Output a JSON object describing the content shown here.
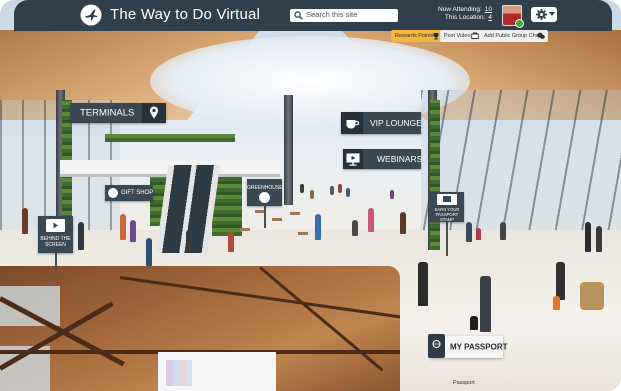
{
  "header": {
    "title": "The Way to Do Virtual",
    "search_placeholder": "Search this site",
    "now_attending_label": "Now Attending:",
    "now_attending_count": "10",
    "this_location_label": "This Location:",
    "this_location_count": "4",
    "logo_icon": "airplane-icon",
    "settings_icon": "gear-icon"
  },
  "actions": {
    "reward_points": "Rewards Points",
    "post_video": "Post Video",
    "add_public_group_chat": "Add Public Group Chat"
  },
  "signs": {
    "terminals": "TERMINALS",
    "vip_lounge": "VIP LOUNGE",
    "webinars": "WEBINARS",
    "gift_shop": "GIFT SHOP",
    "greenhouse": "GREENHOUSE",
    "behind_the_screen": "BEHIND THE SCREEN",
    "earn_passport_stamp": "EARN YOUR PASSPORT STAMP",
    "my_passport": "MY PASSPORT"
  },
  "passport_caption": "Passport",
  "colors": {
    "topbar": "#2f3f4b",
    "sign_bg": "#3a4853",
    "reward_chip": "#f2b73c",
    "online_status": "#3cb043"
  }
}
